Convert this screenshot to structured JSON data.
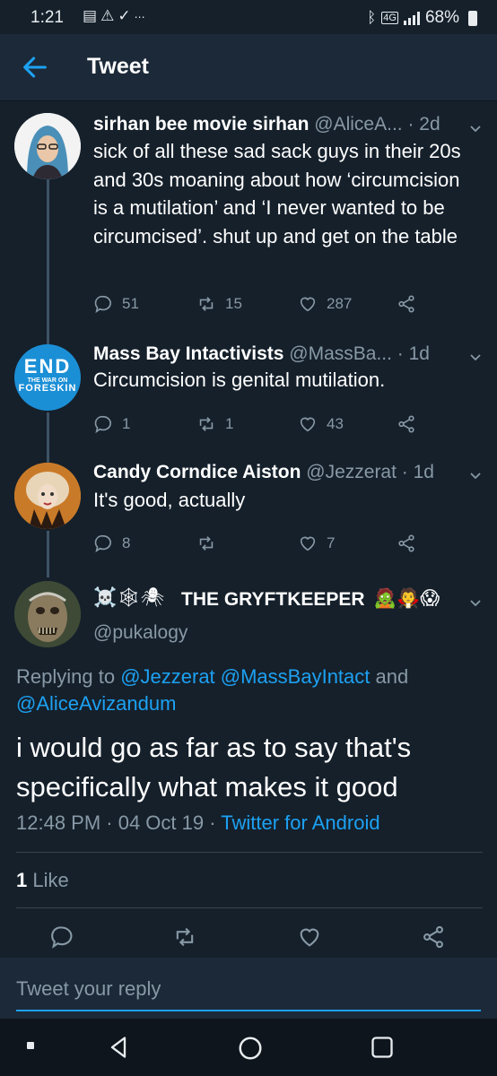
{
  "status_bar": {
    "time": "1:21",
    "left_icons": [
      "keyboard-icon",
      "warning-icon",
      "check-download-icon",
      "more-icon"
    ],
    "network": "4G",
    "battery": "68%"
  },
  "header": {
    "title": "Tweet",
    "back_icon": "back-arrow-icon"
  },
  "tweets": [
    {
      "name": "sirhan bee movie sirhan",
      "handle": "@AliceA... · 2d",
      "text": "sick of all these sad sack guys in their 20s and 30s moaning about how ‘circumcision is a mutilation’ and ‘I never wanted to be circumcised’. shut up and get on the table",
      "replies": "51",
      "retweets": "15",
      "likes": "287"
    },
    {
      "name": "Mass Bay Intactivists",
      "handle": "@MassBa... · 1d",
      "avatar_text": {
        "line1": "END",
        "line2": "THE WAR ON",
        "line3": "FORESKIN"
      },
      "text": "Circumcision is genital mutilation.",
      "replies": "1",
      "retweets": "1",
      "likes": "43"
    },
    {
      "name": "Candy Corndice Aiston",
      "handle": "@Jezzerat · 1d",
      "text": "It's good, actually",
      "replies": "8",
      "retweets": "",
      "likes": "7"
    }
  ],
  "focused_tweet": {
    "name_emoji_prefix": "☠️🕸🕷",
    "name": "THE GRYFTKEEPER",
    "name_emoji_suffix": "🧟🧛😱",
    "handle": "@pukalogy",
    "replying_prefix": "Replying to ",
    "replying_users": "@Jezzerat @MassBayIntact",
    "replying_and": " and ",
    "replying_last": "@AliceAvizandum",
    "text": "i would go as far as to say that's specifically what makes it good",
    "timestamp": "12:48 PM · 04 Oct 19 · ",
    "source": "Twitter for Android",
    "like_count": "1",
    "like_label": " Like"
  },
  "reply_box": {
    "placeholder": "Tweet your reply"
  },
  "colors": {
    "background": "#15202b",
    "accent": "#1da1f2",
    "secondary_text": "#8899a6"
  }
}
